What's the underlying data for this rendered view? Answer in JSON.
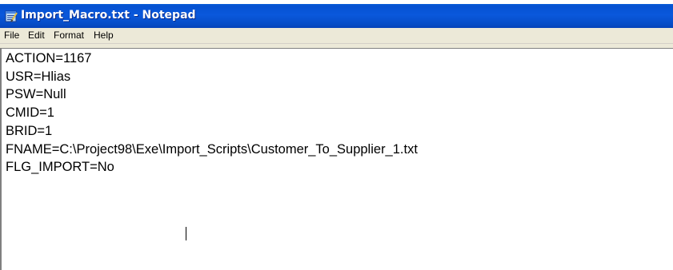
{
  "window": {
    "title": "Import_Macro.txt - Notepad",
    "app_icon": "notepad-icon"
  },
  "menu": {
    "items": [
      "File",
      "Edit",
      "Format",
      "Help"
    ]
  },
  "editor": {
    "lines": [
      "ACTION=1167",
      "USR=Hlias",
      "PSW=Null",
      "CMID=1",
      "BRID=1",
      "FNAME=C:\\Project98\\Exe\\Import_Scripts\\Customer_To_Supplier_1.txt",
      "FLG_IMPORT=No"
    ]
  },
  "colors": {
    "titlebar": "#0a58dc",
    "menubar": "#ece9d8",
    "background": "#ffffff"
  }
}
